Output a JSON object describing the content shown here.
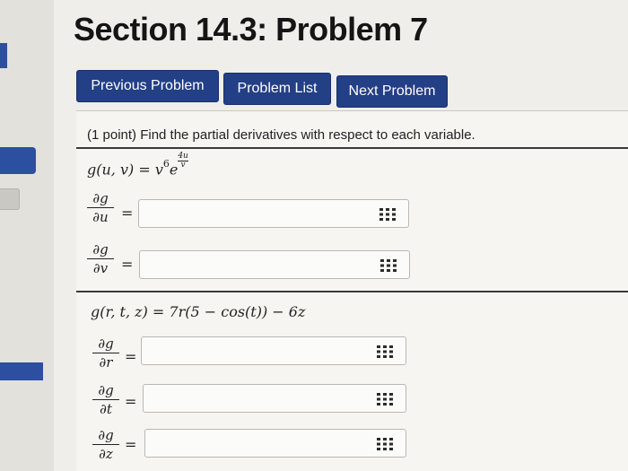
{
  "page": {
    "title": "Section 14.3: Problem 7"
  },
  "nav": {
    "previous_label": "Previous Problem",
    "list_label": "Problem List",
    "next_label": "Next Problem"
  },
  "problem": {
    "prompt": "(1 point) Find the partial derivatives with respect to each variable.",
    "part1": {
      "function_base": "g(u, v) = v",
      "exp_v": "6",
      "exp_e_label": "e",
      "exp_num": "4u",
      "exp_den": "v",
      "derivatives": [
        {
          "num": "∂g",
          "den": "∂u",
          "value": ""
        },
        {
          "num": "∂g",
          "den": "∂v",
          "value": ""
        }
      ]
    },
    "part2": {
      "function": "g(r, t, z) = 7r(5 − cos(t)) − 6z",
      "derivatives": [
        {
          "num": "∂g",
          "den": "∂r",
          "value": ""
        },
        {
          "num": "∂g",
          "den": "∂t",
          "value": ""
        },
        {
          "num": "∂g",
          "den": "∂z",
          "value": ""
        }
      ]
    },
    "equals": "="
  },
  "icons": {
    "palette": "grid-icon"
  },
  "colors": {
    "button_bg": "#233f86",
    "sidebar_accent": "#2c4fa0"
  }
}
